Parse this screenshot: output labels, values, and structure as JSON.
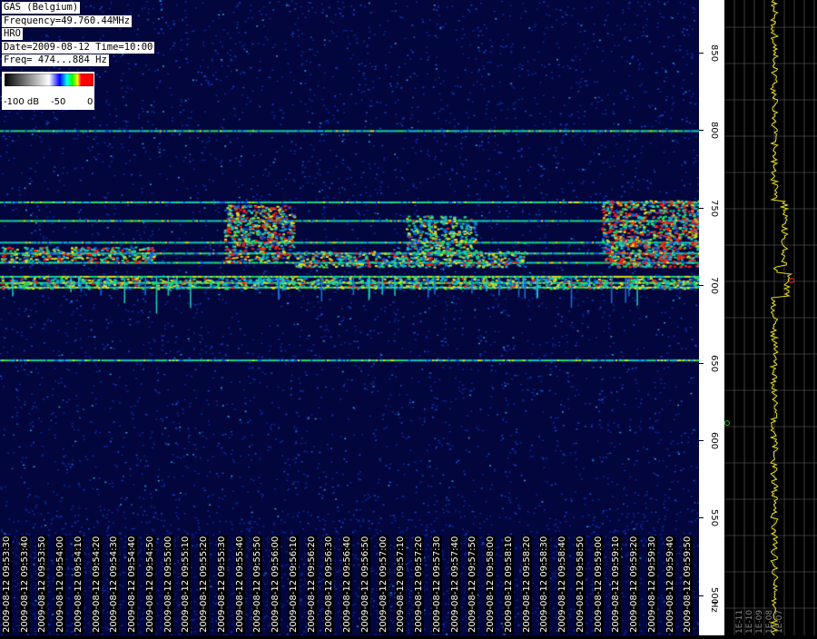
{
  "info": {
    "station": "GAS (Belgium)",
    "frequency": "Frequency=49.760.44MHz",
    "mode": "HRO",
    "datetime": "Date=2009-08-12 Time=10:00",
    "freq_range": "Freq= 474...884 Hz"
  },
  "legend": {
    "min_label": "-100 dB",
    "mid_label": "-50",
    "max_label": "0",
    "colors": [
      "#000080",
      "#0000ff",
      "#00ffff",
      "#00ff00",
      "#ffff00",
      "#ff0000",
      "#ff0000"
    ]
  },
  "time_axis": {
    "labels": [
      "2009-08-12 09:53:30",
      "2009-08-12 09:53:40",
      "2009-08-12 09:53:50",
      "2009-08-12 09:54:00",
      "2009-08-12 09:54:10",
      "2009-08-12 09:54:20",
      "2009-08-12 09:54:30",
      "2009-08-12 09:54:40",
      "2009-08-12 09:54:50",
      "2009-08-12 09:55:00",
      "2009-08-12 09:55:10",
      "2009-08-12 09:55:20",
      "2009-08-12 09:55:30",
      "2009-08-12 09:55:40",
      "2009-08-12 09:55:50",
      "2009-08-12 09:56:00",
      "2009-08-12 09:56:10",
      "2009-08-12 09:56:20",
      "2009-08-12 09:56:30",
      "2009-08-12 09:56:40",
      "2009-08-12 09:56:50",
      "2009-08-12 09:57:00",
      "2009-08-12 09:57:10",
      "2009-08-12 09:57:20",
      "2009-08-12 09:57:30",
      "2009-08-12 09:57:40",
      "2009-08-12 09:57:50",
      "2009-08-12 09:58:00",
      "2009-08-12 09:58:10",
      "2009-08-12 09:58:20",
      "2009-08-12 09:58:30",
      "2009-08-12 09:58:40",
      "2009-08-12 09:58:50",
      "2009-08-12 09:59:00",
      "2009-08-12 09:59:10",
      "2009-08-12 09:59:20",
      "2009-08-12 09:59:30",
      "2009-08-12 09:59:40",
      "2009-08-12 09:59:50"
    ]
  },
  "freq_axis": {
    "unit": "Hz",
    "min_hz": 474,
    "max_hz": 884,
    "labels": [
      {
        "text": "500",
        "hz": 500
      },
      {
        "text": "550",
        "hz": 550
      },
      {
        "text": "600",
        "hz": 600
      },
      {
        "text": "650",
        "hz": 650
      },
      {
        "text": "700",
        "hz": 700
      },
      {
        "text": "750",
        "hz": 750
      },
      {
        "text": "800",
        "hz": 800
      },
      {
        "text": "850",
        "hz": 850
      }
    ]
  },
  "profile": {
    "labels": [
      "1E-11",
      "1E-10",
      "1E-09",
      "1E-08",
      "1E-07"
    ]
  },
  "spectrum": {
    "horizontal_bands_hz": [
      699,
      702,
      706,
      715,
      721,
      728,
      742,
      754,
      800,
      652
    ],
    "bright_regions": [
      {
        "t_start": 0.0,
        "t_end": 0.22,
        "f_low": 715,
        "f_high": 725,
        "level": 0.85
      },
      {
        "t_start": 0.32,
        "t_end": 0.42,
        "f_low": 715,
        "f_high": 752,
        "level": 0.9
      },
      {
        "t_start": 0.42,
        "t_end": 0.75,
        "f_low": 712,
        "f_high": 722,
        "level": 0.8
      },
      {
        "t_start": 0.58,
        "t_end": 0.68,
        "f_low": 720,
        "f_high": 745,
        "level": 0.75
      },
      {
        "t_start": 0.86,
        "t_end": 1.0,
        "f_low": 712,
        "f_high": 755,
        "level": 1.0
      },
      {
        "t_start": 0.0,
        "t_end": 1.0,
        "f_low": 698,
        "f_high": 705,
        "level": 0.75
      }
    ]
  }
}
